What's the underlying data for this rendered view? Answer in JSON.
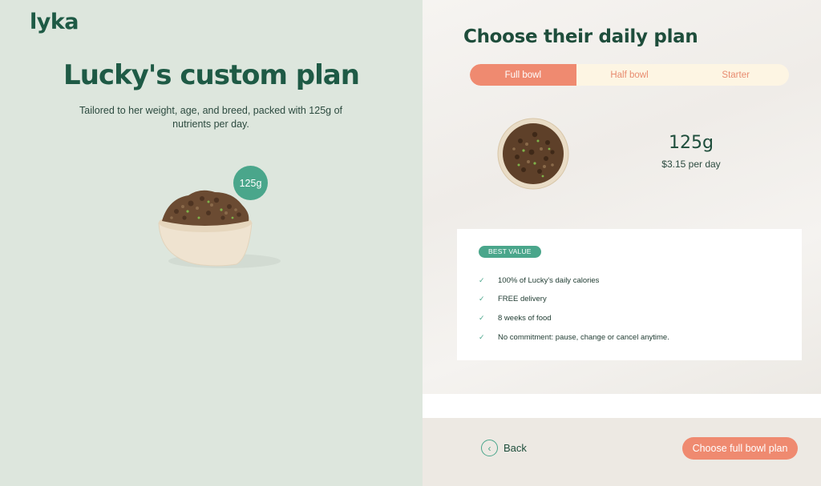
{
  "brand": {
    "logo": "lyka"
  },
  "hero": {
    "title": "Lucky's custom plan",
    "subtitle": "Tailored to her weight, age, and breed, packed with 125g of nutrients per day.",
    "portion_badge": "125g"
  },
  "plan": {
    "title": "Choose their daily plan",
    "tabs": [
      {
        "label": "Full bowl",
        "active": true
      },
      {
        "label": "Half bowl",
        "active": false
      },
      {
        "label": "Starter",
        "active": false
      }
    ],
    "grams": "125g",
    "price_per_day": "$3.15 per day",
    "badge": "BEST VALUE",
    "features": [
      "100% of Lucky's daily calories",
      "FREE delivery",
      "8 weeks of food",
      "No commitment: pause, change or cancel anytime."
    ]
  },
  "footer": {
    "back_label": "Back",
    "cta_label": "Choose full bowl plan"
  },
  "colors": {
    "brand_green": "#1e5a45",
    "accent_teal": "#4aa68b",
    "accent_coral": "#ef8a70",
    "left_bg": "#dde6dd"
  }
}
